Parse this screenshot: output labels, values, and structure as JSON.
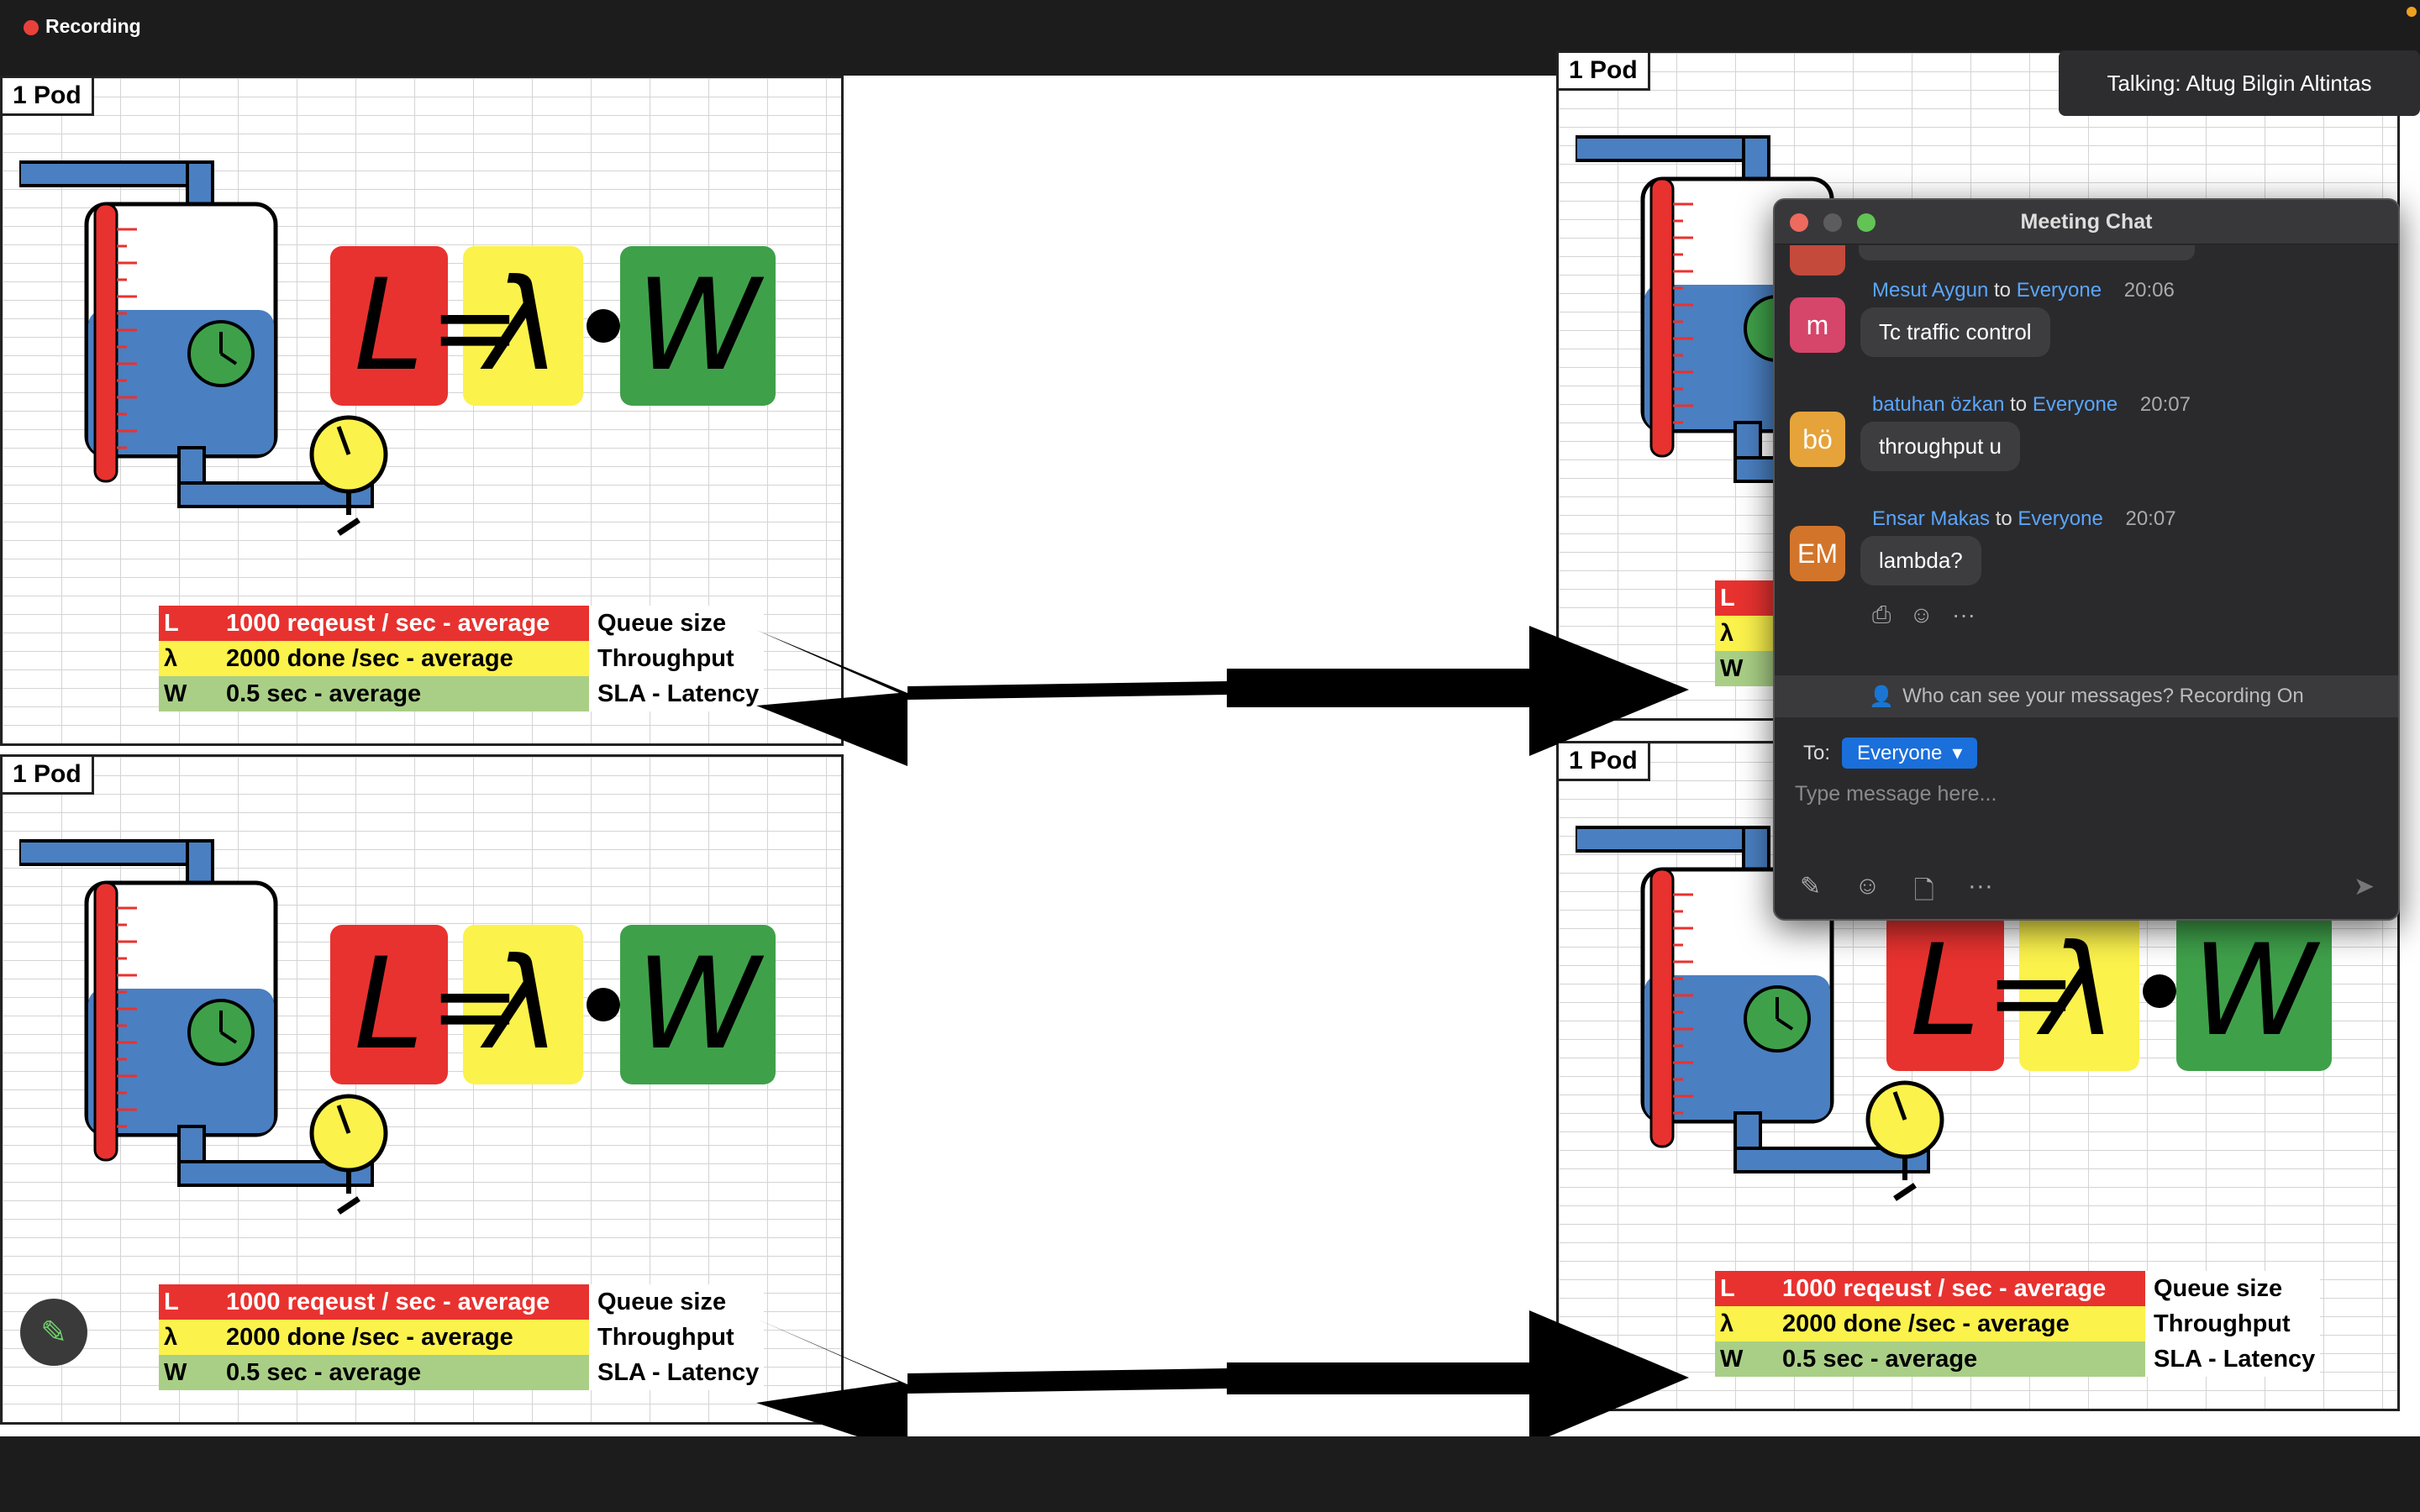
{
  "recording": {
    "label": "Recording",
    "color": "#e8413c"
  },
  "talking": {
    "text": "Talking: Altug Bilgin Altintas"
  },
  "panels": [
    {
      "label": "1 Pod"
    },
    {
      "label": "1 Pod"
    },
    {
      "label": "1 Pod"
    },
    {
      "label": "1 Pod"
    }
  ],
  "formula": {
    "L": "L",
    "eq": "=",
    "lambda": "λ",
    "W": "W"
  },
  "table": [
    {
      "sym": "L",
      "desc": "1000  reqeust / sec - average",
      "name": "Queue size"
    },
    {
      "sym": "λ",
      "desc": "2000 done /sec - average",
      "name": "Throughput"
    },
    {
      "sym": "W",
      "desc": "0.5 sec  - average",
      "name": "SLA - Latency"
    }
  ],
  "chat": {
    "title": "Meeting Chat",
    "connector": "to",
    "messages": [
      {
        "initials": "m",
        "avatar_color": "#d6456a",
        "sender": "Mesut Aygun",
        "to": "Everyone",
        "time": "20:06",
        "text": "Tc traffic control"
      },
      {
        "initials": "bö",
        "avatar_color": "#e6a33a",
        "sender": "batuhan özkan",
        "to": "Everyone",
        "time": "20:07",
        "text": "throughput u"
      },
      {
        "initials": "EM",
        "avatar_color": "#d2752a",
        "sender": "Ensar Makas",
        "to": "Everyone",
        "time": "20:07",
        "text": "lambda?"
      }
    ],
    "notice": "Who can see your messages? Recording On",
    "to_label": "To:",
    "to_value": "Everyone",
    "placeholder": "Type message here...",
    "colors": {
      "accent": "#1a6fdb",
      "name_link": "#5aa6ff"
    }
  }
}
